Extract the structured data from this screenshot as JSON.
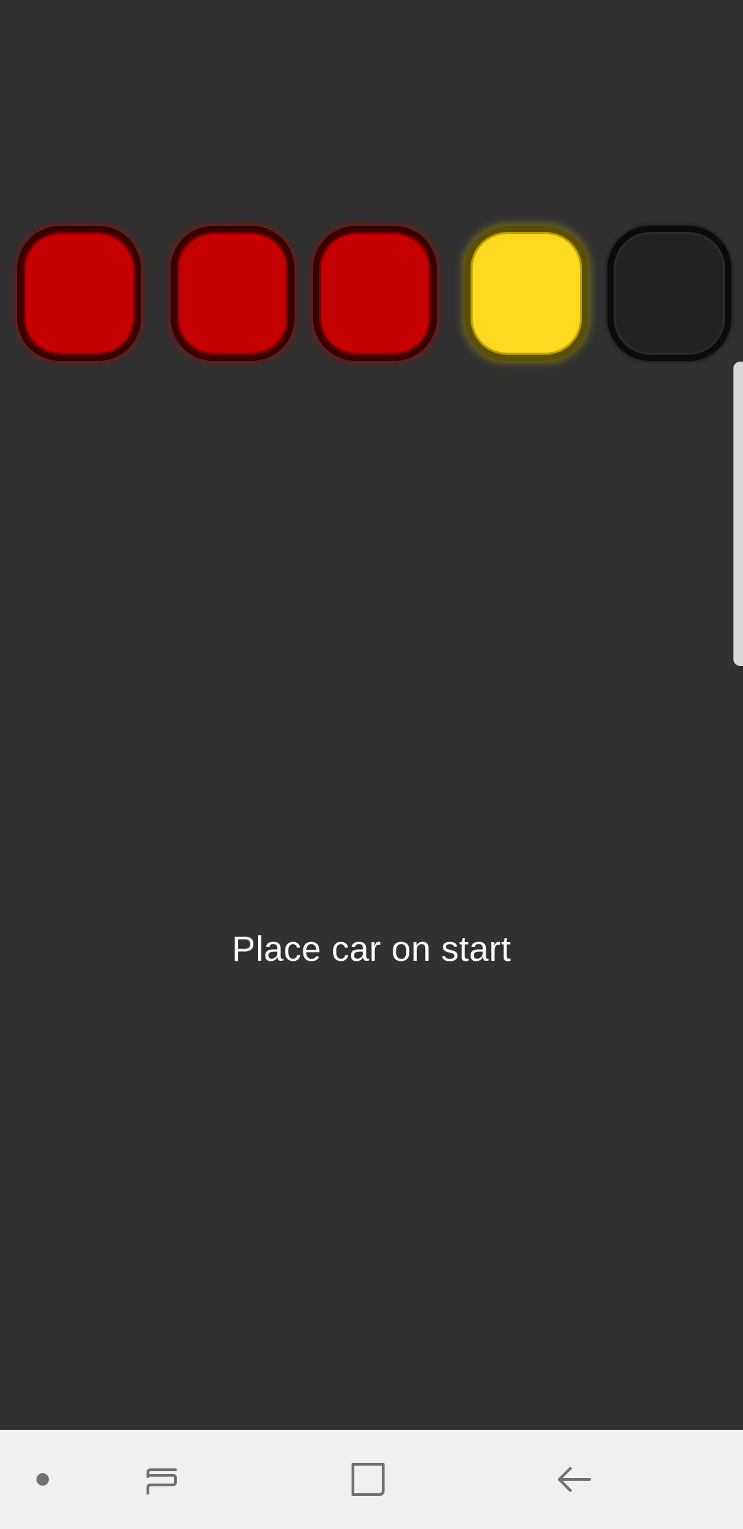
{
  "lights": [
    {
      "state": "red",
      "color": "#c50000"
    },
    {
      "state": "red",
      "color": "#c50000"
    },
    {
      "state": "red",
      "color": "#c50000"
    },
    {
      "state": "yellow",
      "color": "#ffd91f"
    },
    {
      "state": "off",
      "color": "#222222"
    }
  ],
  "status": {
    "message": "Place car on start"
  },
  "navbar": {
    "dot_icon": "dot-icon",
    "recents_icon": "recent-apps-icon",
    "home_icon": "home-icon",
    "back_icon": "back-arrow-icon"
  },
  "colors": {
    "background": "#313131",
    "text": "#ffffff",
    "navbar": "#f0f0f0"
  }
}
